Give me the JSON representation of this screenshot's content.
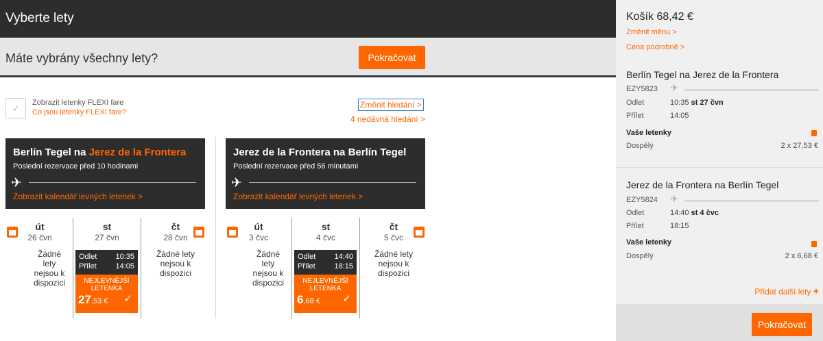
{
  "header": {
    "title": "Vyberte lety"
  },
  "question_bar": {
    "text": "Máte vybrány všechny lety?",
    "continue_label": "Pokračovat"
  },
  "flexi": {
    "line1": "Zobrazit letenky FLEXI fare",
    "line2": "Co jsou letenky FLEXI fare?"
  },
  "search": {
    "change_label": "Změnit hledání >",
    "recent_label": "4 nedávná hledání >"
  },
  "outbound": {
    "origin": "Berlín Tegel na ",
    "destination": "Jerez de la Frontera",
    "recent": "Poslední rezervace před 10 hodinami",
    "calendar_link": "Zobrazit kalendář levných letenek >",
    "days": [
      {
        "day": "út",
        "date": "26 čvn",
        "na": "Žádné lety nejsou k dispozici"
      },
      {
        "day": "st",
        "date": "27 čvn",
        "dep_label": "Odlet",
        "dep_time": "10:35",
        "arr_label": "Přílet",
        "arr_time": "14:05",
        "cheap_label": "NEJLEVNĚJŠÍ LETENKA",
        "price_main": "27",
        "price_dec": ",53 €",
        "check": "✓"
      },
      {
        "day": "čt",
        "date": "28 čvn",
        "na": "Žádné lety nejsou k dispozici"
      }
    ]
  },
  "inbound": {
    "title": "Jerez de la Frontera na Berlín Tegel",
    "recent": "Poslední rezervace před 56 minutami",
    "calendar_link": "Zobrazit kalendář levných letenek >",
    "days": [
      {
        "day": "út",
        "date": "3 čvc",
        "na": "Žádné lety nejsou k dispozici"
      },
      {
        "day": "st",
        "date": "4 čvc",
        "dep_label": "Odlet",
        "dep_time": "14:40",
        "arr_label": "Přílet",
        "arr_time": "18:15",
        "cheap_label": "NEJLEVNĚJŠÍ LETENKA",
        "price_main": "6",
        "price_dec": ",68 €",
        "check": "✓"
      },
      {
        "day": "čt",
        "date": "5 čvc",
        "na": "Žádné lety nejsou k dispozici"
      }
    ]
  },
  "cart": {
    "title": "Košík 68,42 €",
    "change_currency": "Změnit měnu >",
    "price_detail": "Cena podrobně >",
    "segments": [
      {
        "title": "Berlín Tegel na Jerez de la Frontera",
        "flight": "EZY5823",
        "dep_label": "Odlet",
        "dep_time": "10:35",
        "dep_date": "st 27 čvn",
        "arr_label": "Přílet",
        "arr_time": "14:05",
        "tickets_label": "Vaše letenky",
        "pax": "Dospělý",
        "amount": "2 x 27,53 €"
      },
      {
        "title": "Jerez de la Frontera na Berlín Tegel",
        "flight": "EZY5824",
        "dep_label": "Odlet",
        "dep_time": "14:40",
        "dep_date": "st 4 čvc",
        "arr_label": "Přílet",
        "arr_time": "18:15",
        "tickets_label": "Vaše letenky",
        "pax": "Dospělý",
        "amount": "2 x 6,68 €"
      }
    ],
    "add_more": "Přidat další lety",
    "add_plus": "+",
    "continue_label": "Pokračovat"
  },
  "icons": {
    "plane": "✈",
    "check": "✓"
  }
}
